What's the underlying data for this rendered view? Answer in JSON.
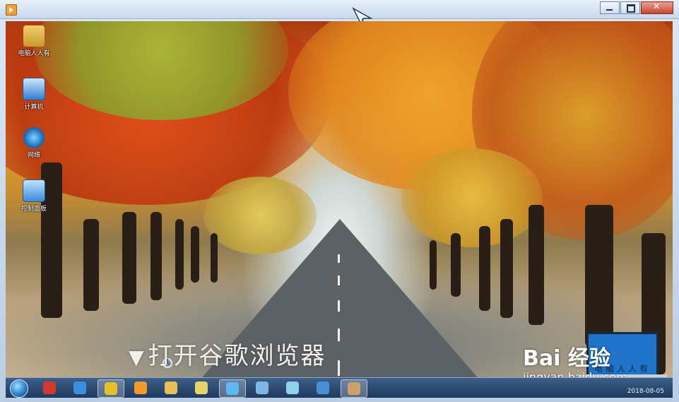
{
  "window": {
    "title": "",
    "app_icon": "media-player-icon",
    "controls": {
      "minimize": "minimize-icon",
      "maximize": "maximize-icon",
      "close": "close-icon"
    }
  },
  "desktop": {
    "icons": [
      {
        "name": "user-folder-icon",
        "label": "电脑人人有"
      },
      {
        "name": "computer-icon",
        "label": "计算机"
      },
      {
        "name": "network-icon",
        "label": "网络"
      },
      {
        "name": "control-panel-icon",
        "label": "控制面板"
      }
    ],
    "caption": {
      "marker": "▼",
      "text": "打开谷歌浏览器"
    }
  },
  "watermark": {
    "brand": "Bai 经验",
    "url": "jingyan.baidu.com",
    "laptop_text": "电脑人人有"
  },
  "taskbar": {
    "start_icon": "windows-start-icon",
    "items": [
      {
        "name": "chess-app-icon",
        "color": "#d43a2a",
        "active": false
      },
      {
        "name": "ie-browser-icon",
        "color": "#3b8fe0",
        "active": false
      },
      {
        "name": "chrome-browser-icon",
        "color": "#e6c12b",
        "active": true
      },
      {
        "name": "media-player-icon",
        "color": "#f29a2e",
        "active": false
      },
      {
        "name": "file-explorer-icon",
        "color": "#e7c05a",
        "active": false
      },
      {
        "name": "gallery-icon",
        "color": "#e6d36a",
        "active": false
      },
      {
        "name": "cloud-drive-icon",
        "color": "#5cb8f0",
        "active": true
      },
      {
        "name": "notepad-icon",
        "color": "#7fb6e6",
        "active": false
      },
      {
        "name": "pinwheel-app-icon",
        "color": "#8fd3e9",
        "active": false
      },
      {
        "name": "screen-capture-icon",
        "color": "#4a8fd6",
        "active": false
      },
      {
        "name": "paint-icon",
        "color": "#cfa06a",
        "active": true
      }
    ],
    "clock_text": "2018-08-05"
  }
}
